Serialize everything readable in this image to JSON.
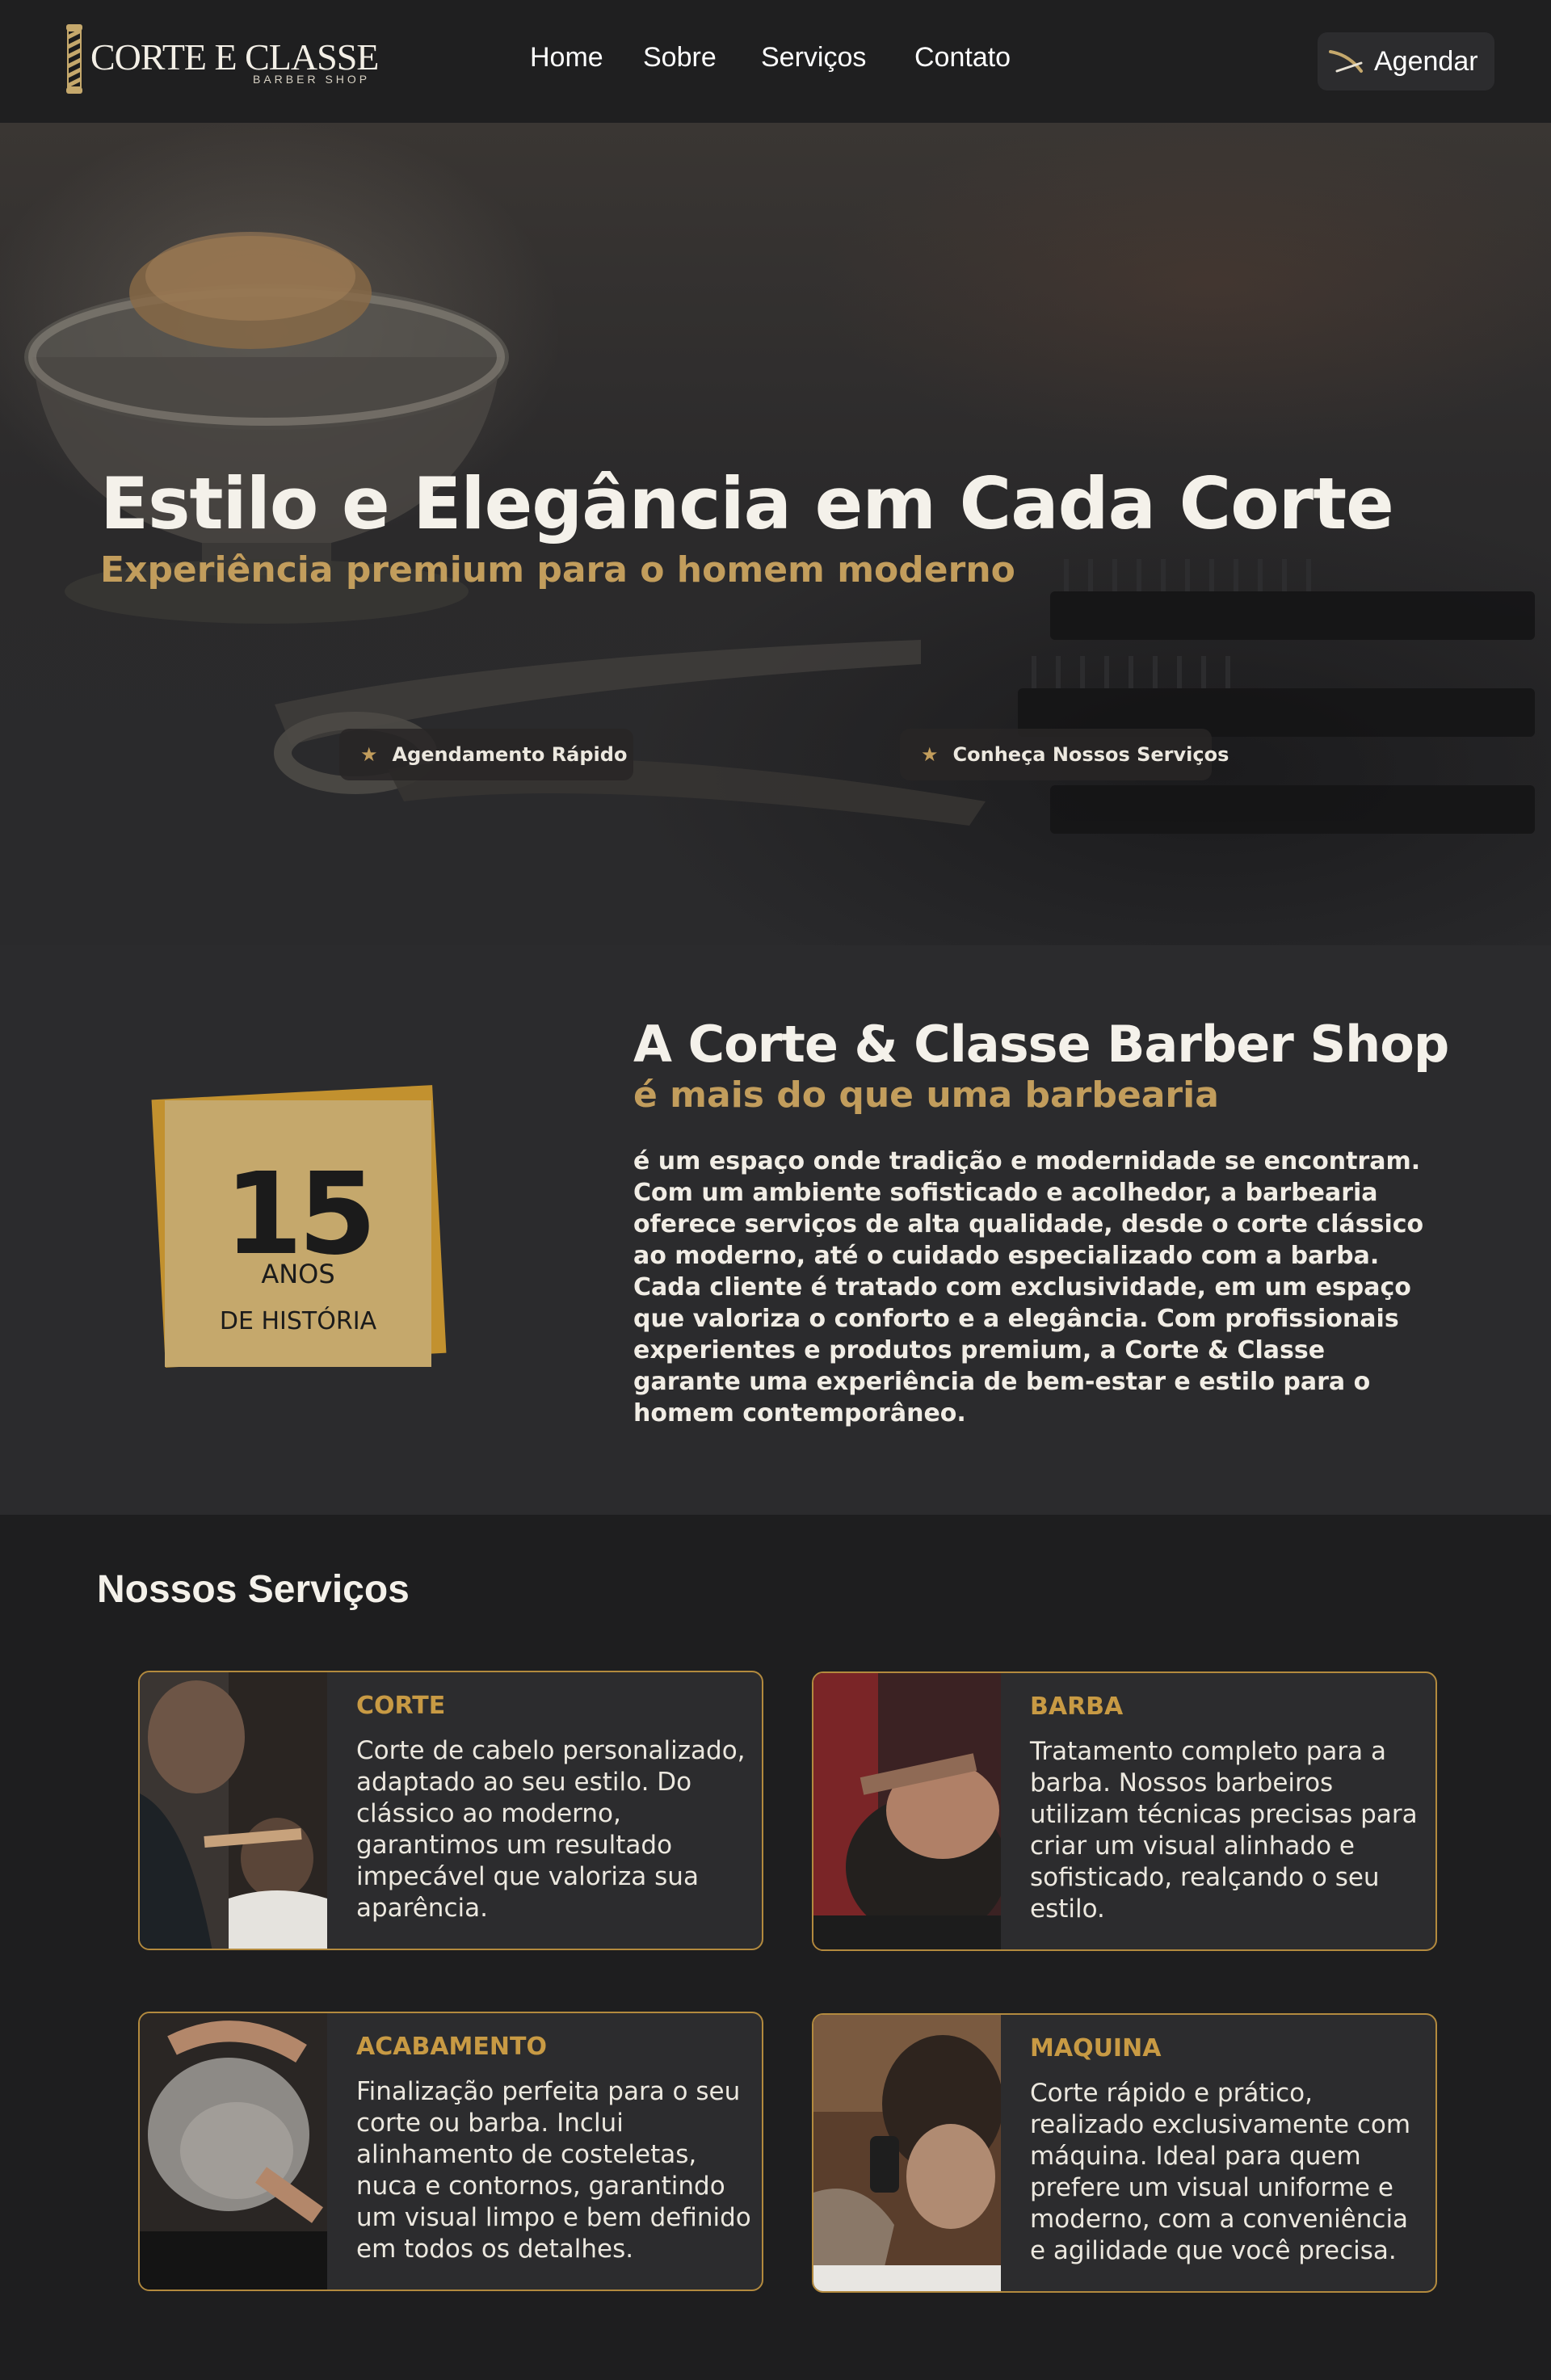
{
  "nav": {
    "logo_title": "CORTE E CLASSE",
    "logo_subtitle": "BARBER SHOP",
    "items": [
      "Home",
      "Sobre",
      "Serviços",
      "Contato"
    ],
    "cta_label": "Agendar"
  },
  "hero": {
    "title": "Estilo e Elegância em Cada Corte",
    "subtitle": "Experiência premium para o homem moderno",
    "pills": [
      "Agendamento Rápido",
      "Conheça Nossos Serviços"
    ]
  },
  "about": {
    "badge_number": "15",
    "badge_line1": "ANOS",
    "badge_line2": "DE HISTÓRIA",
    "title": "A Corte & Classe Barber Shop",
    "subtitle": "é mais do que uma barbearia",
    "text": "é um espaço onde tradição e modernidade se encontram. Com um ambiente sofisticado e acolhedor, a barbearia oferece serviços de alta qualidade, desde o corte clássico ao moderno, até o cuidado especializado com a barba. Cada cliente é tratado com exclusividade, em um espaço que valoriza o conforto e a elegância. Com profissionais experientes e produtos premium, a Corte & Classe garante uma experiência de bem-estar e estilo para o homem contemporâneo."
  },
  "services": {
    "title": "Nossos Serviços",
    "cards": [
      {
        "title": "CORTE",
        "text": "Corte de cabelo personalizado, adaptado ao seu estilo. Do clássico ao moderno, garantimos um resultado impecável que valoriza sua aparência."
      },
      {
        "title": "BARBA",
        "text": "Tratamento completo para a barba. Nossos barbeiros utilizam técnicas precisas para criar um visual alinhado e sofisticado, realçando o seu estilo."
      },
      {
        "title": "ACABAMENTO",
        "text": "Finalização perfeita para o seu corte ou barba. Inclui alinhamento de costeletas, nuca e contornos, garantindo um visual limpo e bem definido em todos os detalhes."
      },
      {
        "title": "MAQUINA",
        "text": "Corte rápido e prático, realizado exclusivamente com máquina. Ideal para quem prefere um visual uniforme e moderno, com a conveniência e agilidade que você precisa."
      }
    ]
  },
  "colors": {
    "gold": "#c29d5c",
    "card_border": "#b38a3e",
    "background": "#1e1e1f"
  }
}
